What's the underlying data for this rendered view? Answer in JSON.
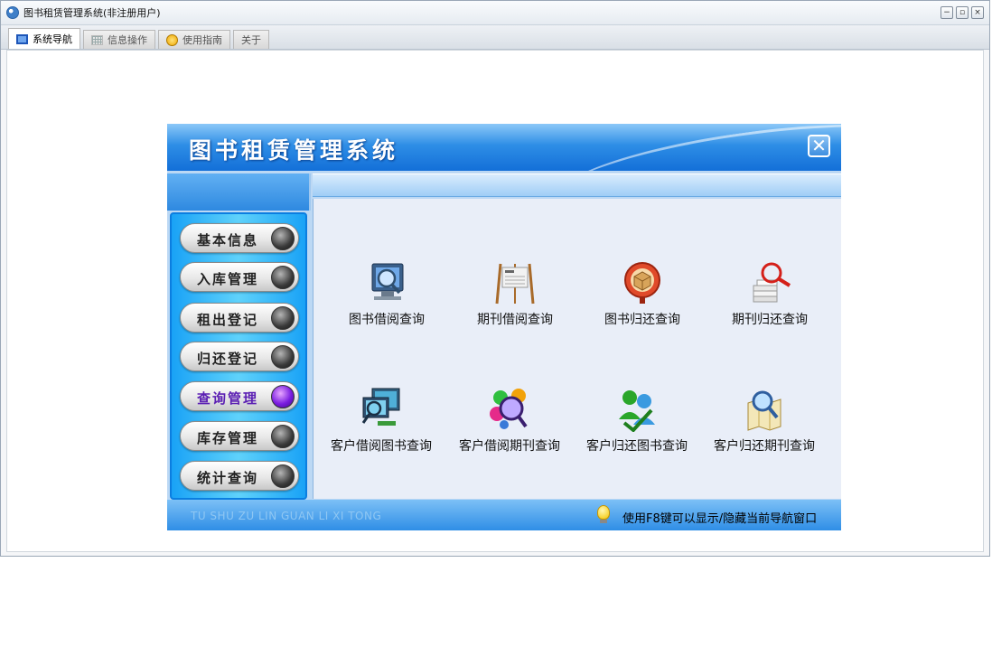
{
  "window": {
    "title": "图书租赁管理系统(非注册用户)",
    "minimize_label": "−",
    "restore_label": "▫",
    "close_label": "×"
  },
  "tabs": [
    {
      "label": "系统导航",
      "icon": "monitor-icon",
      "active": true
    },
    {
      "label": "信息操作",
      "icon": "grid-icon",
      "active": false
    },
    {
      "label": "使用指南",
      "icon": "smile-icon",
      "active": false
    },
    {
      "label": "关于",
      "icon": "",
      "active": false
    }
  ],
  "panel": {
    "title": "图书租赁管理系统",
    "close_label": "✕"
  },
  "sidebar": {
    "items": [
      {
        "label": "基本信息",
        "active": false
      },
      {
        "label": "入库管理",
        "active": false
      },
      {
        "label": "租出登记",
        "active": false
      },
      {
        "label": "归还登记",
        "active": false
      },
      {
        "label": "查询管理",
        "active": true
      },
      {
        "label": "库存管理",
        "active": false
      },
      {
        "label": "统计查询",
        "active": false
      }
    ]
  },
  "functions": [
    {
      "label": "图书借阅查询",
      "icon": "monitor-magnifier-icon"
    },
    {
      "label": "期刊借阅查询",
      "icon": "newspaper-stand-icon"
    },
    {
      "label": "图书归还查询",
      "icon": "box-magnifier-icon"
    },
    {
      "label": "期刊归还查询",
      "icon": "papers-magnifier-icon"
    },
    {
      "label": "客户借阅图书查询",
      "icon": "computers-icon"
    },
    {
      "label": "客户借阅期刊查询",
      "icon": "colorful-magnifier-icon"
    },
    {
      "label": "客户归还图书查询",
      "icon": "users-icon"
    },
    {
      "label": "客户归还期刊查询",
      "icon": "map-magnifier-icon"
    }
  ],
  "status": {
    "pinyin": "TU SHU ZU LIN  GUAN LI XI TONG",
    "hint": "使用F8键可以显示/隐藏当前导航窗口"
  },
  "colors": {
    "header_blue": "#1f7fe0",
    "sidebar_cyan": "#3cc0f8",
    "active_led_purple": "#7a1ce0",
    "content_bg": "#e9eef8"
  }
}
